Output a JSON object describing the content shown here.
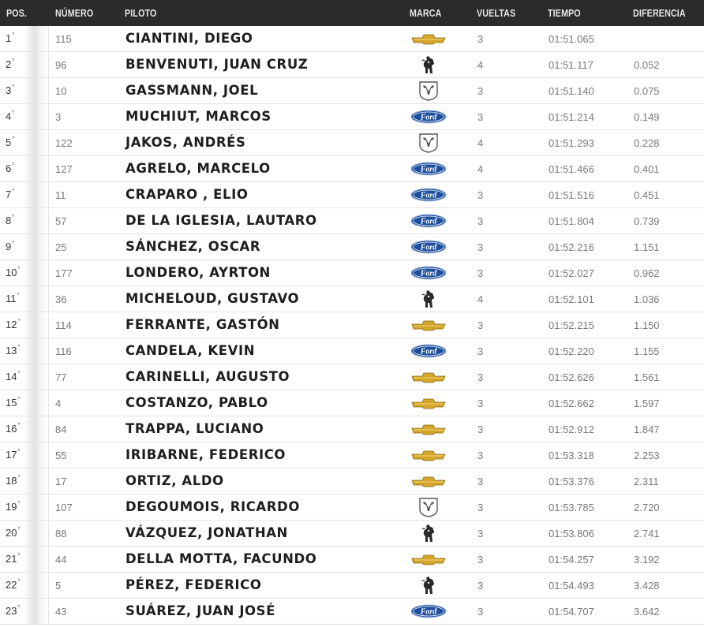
{
  "header": {
    "pos": "POS.",
    "number": "NÚMERO",
    "pilot": "PILOTO",
    "brand": "MARCA",
    "laps": "VUELTAS",
    "time": "TIEMPO",
    "difference": "DIFERENCIA"
  },
  "brand_logo_text": {
    "ford": "Ford"
  },
  "rows": [
    {
      "pos": "1",
      "suffix": "°",
      "number": "115",
      "pilot": "CIANTINI, DIEGO",
      "brand": "chevrolet-logo",
      "laps": "3",
      "time": "01:51.065",
      "diff": ""
    },
    {
      "pos": "2",
      "suffix": "°",
      "number": "96",
      "pilot": "BENVENUTI, JUAN CRUZ",
      "brand": "torino-logo",
      "laps": "4",
      "time": "01:51.117",
      "diff": "0.052"
    },
    {
      "pos": "3",
      "suffix": "°",
      "number": "10",
      "pilot": "GASSMANN, JOEL",
      "brand": "dodge-logo",
      "laps": "3",
      "time": "01:51.140",
      "diff": "0.075"
    },
    {
      "pos": "4",
      "suffix": "°",
      "number": "3",
      "pilot": "MUCHIUT, MARCOS",
      "brand": "ford-logo",
      "laps": "3",
      "time": "01:51.214",
      "diff": "0.149"
    },
    {
      "pos": "5",
      "suffix": "°",
      "number": "122",
      "pilot": "JAKOS, ANDRÉS",
      "brand": "dodge-logo",
      "laps": "4",
      "time": "01:51.293",
      "diff": "0.228"
    },
    {
      "pos": "6",
      "suffix": "°",
      "number": "127",
      "pilot": "AGRELO, MARCELO",
      "brand": "ford-logo",
      "laps": "4",
      "time": "01:51.466",
      "diff": "0.401"
    },
    {
      "pos": "7",
      "suffix": "°",
      "number": "11",
      "pilot": "CRAPARO , ELIO",
      "brand": "ford-logo",
      "laps": "3",
      "time": "01:51.516",
      "diff": "0.451"
    },
    {
      "pos": "8",
      "suffix": "°",
      "number": "57",
      "pilot": "DE LA IGLESIA, LAUTARO",
      "brand": "ford-logo",
      "laps": "3",
      "time": "01:51.804",
      "diff": "0.739"
    },
    {
      "pos": "9",
      "suffix": "°",
      "number": "25",
      "pilot": "SÁNCHEZ, OSCAR",
      "brand": "ford-logo",
      "laps": "3",
      "time": "01:52.216",
      "diff": "1.151"
    },
    {
      "pos": "10",
      "suffix": "°",
      "number": "177",
      "pilot": "LONDERO, AYRTON",
      "brand": "ford-logo",
      "laps": "3",
      "time": "01:52.027",
      "diff": "0.962"
    },
    {
      "pos": "11",
      "suffix": "°",
      "number": "36",
      "pilot": "MICHELOUD, GUSTAVO",
      "brand": "torino-logo",
      "laps": "4",
      "time": "01:52.101",
      "diff": "1.036"
    },
    {
      "pos": "12",
      "suffix": "°",
      "number": "114",
      "pilot": "FERRANTE, GASTÓN",
      "brand": "chevrolet-logo",
      "laps": "3",
      "time": "01:52.215",
      "diff": "1.150"
    },
    {
      "pos": "13",
      "suffix": "°",
      "number": "116",
      "pilot": "CANDELA, KEVIN",
      "brand": "ford-logo",
      "laps": "3",
      "time": "01:52.220",
      "diff": "1.155"
    },
    {
      "pos": "14",
      "suffix": "°",
      "number": "77",
      "pilot": "CARINELLI, AUGUSTO",
      "brand": "chevrolet-logo",
      "laps": "3",
      "time": "01:52.626",
      "diff": "1.561"
    },
    {
      "pos": "15",
      "suffix": "°",
      "number": "4",
      "pilot": "COSTANZO, PABLO",
      "brand": "chevrolet-logo",
      "laps": "3",
      "time": "01:52.662",
      "diff": "1.597"
    },
    {
      "pos": "16",
      "suffix": "°",
      "number": "84",
      "pilot": "TRAPPA, LUCIANO",
      "brand": "chevrolet-logo",
      "laps": "3",
      "time": "01:52.912",
      "diff": "1.847"
    },
    {
      "pos": "17",
      "suffix": "°",
      "number": "55",
      "pilot": "IRIBARNE, FEDERICO",
      "brand": "chevrolet-logo",
      "laps": "3",
      "time": "01:53.318",
      "diff": "2.253"
    },
    {
      "pos": "18",
      "suffix": "°",
      "number": "17",
      "pilot": "ORTIZ, ALDO",
      "brand": "chevrolet-logo",
      "laps": "3",
      "time": "01:53.376",
      "diff": "2.311"
    },
    {
      "pos": "19",
      "suffix": "°",
      "number": "107",
      "pilot": "DEGOUMOIS, RICARDO",
      "brand": "dodge-logo",
      "laps": "3",
      "time": "01:53.785",
      "diff": "2.720"
    },
    {
      "pos": "20",
      "suffix": "°",
      "number": "88",
      "pilot": "VÁZQUEZ, JONATHAN",
      "brand": "torino-logo",
      "laps": "3",
      "time": "01:53.806",
      "diff": "2.741"
    },
    {
      "pos": "21",
      "suffix": "°",
      "number": "44",
      "pilot": "DELLA MOTTA, FACUNDO",
      "brand": "chevrolet-logo",
      "laps": "3",
      "time": "01:54.257",
      "diff": "3.192"
    },
    {
      "pos": "22",
      "suffix": "°",
      "number": "5",
      "pilot": "PÉREZ, FEDERICO",
      "brand": "torino-logo",
      "laps": "3",
      "time": "01:54.493",
      "diff": "3.428"
    },
    {
      "pos": "23",
      "suffix": "°",
      "number": "43",
      "pilot": "SUÁREZ, JUAN JOSÉ",
      "brand": "ford-logo",
      "laps": "3",
      "time": "01:54.707",
      "diff": "3.642"
    }
  ],
  "colors": {
    "header_bg": "#2b2b2b",
    "chevrolet_gold": "#d4a62a",
    "ford_blue": "#1d4f9c"
  }
}
